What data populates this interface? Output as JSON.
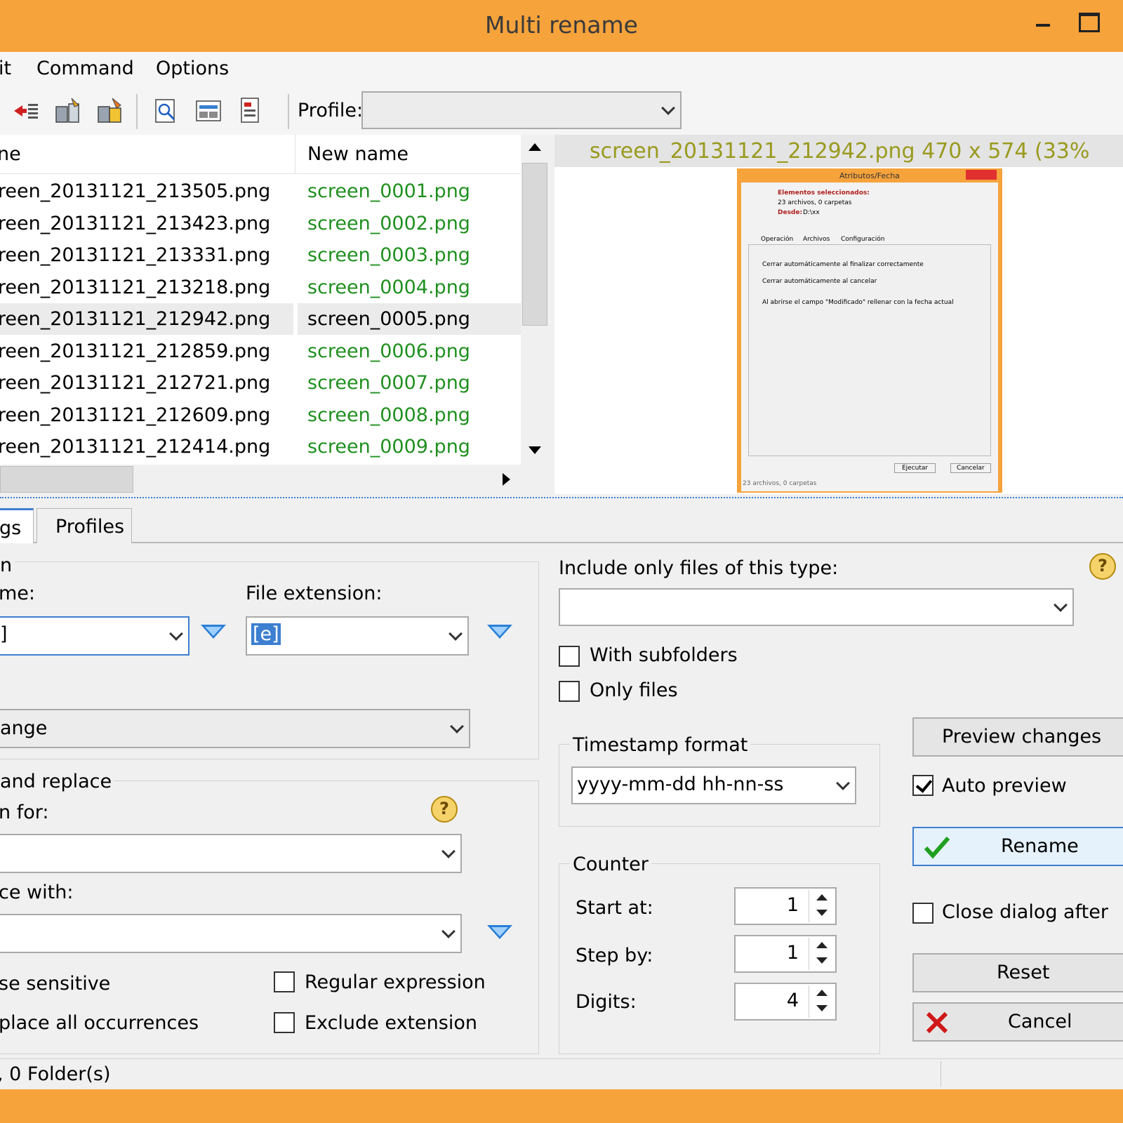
{
  "window": {
    "title": "Multi rename"
  },
  "menu": {
    "items": [
      "it",
      "Command",
      "Options"
    ]
  },
  "toolbar": {
    "profile_label": "Profile:",
    "profile_value": "",
    "icons": [
      "undo-icon",
      "rename-files-icon",
      "edit-rename-icon",
      "search-file-icon",
      "view-file-icon",
      "load-list-icon"
    ]
  },
  "filelist": {
    "columns": [
      "ne",
      "New name"
    ],
    "rows": [
      {
        "old": "screen_20131121_213505.png",
        "new": "screen_0001.png",
        "selected": false
      },
      {
        "old": "screen_20131121_213423.png",
        "new": "screen_0002.png",
        "selected": false
      },
      {
        "old": "screen_20131121_213331.png",
        "new": "screen_0003.png",
        "selected": false
      },
      {
        "old": "screen_20131121_213218.png",
        "new": "screen_0004.png",
        "selected": false
      },
      {
        "old": "screen_20131121_212942.png",
        "new": "screen_0005.png",
        "selected": true
      },
      {
        "old": "screen_20131121_212859.png",
        "new": "screen_0006.png",
        "selected": false
      },
      {
        "old": "screen_20131121_212721.png",
        "new": "screen_0007.png",
        "selected": false
      },
      {
        "old": "screen_20131121_212609.png",
        "new": "screen_0008.png",
        "selected": false
      },
      {
        "old": "screen_20131121_212414.png",
        "new": "screen_0009.png",
        "selected": false
      }
    ]
  },
  "preview": {
    "title": "screen_20131121_212942.png   470 x 574 (33%",
    "thumb": {
      "window_title": "Atributos/Fecha",
      "heading": "Elementos seleccionados:",
      "line1": "23 archivos, 0 carpetas",
      "from_label": "Desde:",
      "from_value": "D:\\xx",
      "tabs": [
        "Operación",
        "Archivos",
        "Configuración"
      ],
      "checks": [
        "Cerrar automáticamente al finalizar correctamente",
        "Cerrar automáticamente al cancelar",
        "Al abrirse el campo \"Modificado\" rellenar con la fecha actual"
      ],
      "ok": "Ejecutar",
      "cancel": "Cancelar",
      "status": "23 archivos, 0 carpetas"
    }
  },
  "tabs": {
    "settings": "gs",
    "profiles": "Profiles"
  },
  "rename_mask": {
    "group_title": "n",
    "name_label": "me:",
    "name_value": "]",
    "ext_label": "File extension:",
    "ext_value": "[e]",
    "case_value": "ange"
  },
  "search_replace": {
    "group_title": " and replace",
    "search_label": "n for:",
    "search_value": "",
    "replace_label": "ce with:",
    "replace_value": "",
    "case_sensitive": "se sensitive",
    "replace_all": "place all occurrences",
    "regex": "Regular expression",
    "exclude_ext": "Exclude extension",
    "regex_checked": false,
    "exclude_checked": false
  },
  "filter": {
    "include_label": "Include only files of this type:",
    "include_value": "",
    "with_subfolders": "With subfolders",
    "only_files": "Only files"
  },
  "timestamp": {
    "group_title": "Timestamp format",
    "value": "yyyy-mm-dd hh-nn-ss"
  },
  "counter": {
    "group_title": "Counter",
    "start_label": "Start at:",
    "start_value": "1",
    "step_label": "Step by:",
    "step_value": "1",
    "digits_label": "Digits:",
    "digits_value": "4"
  },
  "actions": {
    "preview_changes": "Preview changes",
    "auto_preview": "Auto preview",
    "auto_preview_checked": true,
    "rename": "Rename",
    "close_dialog": "Close dialog after",
    "close_dialog_checked": false,
    "reset": "Reset",
    "cancel": "Cancel"
  },
  "status": {
    "text": ", 0 Folder(s)"
  },
  "colors": {
    "accent": "#f6a33c",
    "new_name": "#1f8f1f",
    "focus": "#3d7fd0"
  }
}
